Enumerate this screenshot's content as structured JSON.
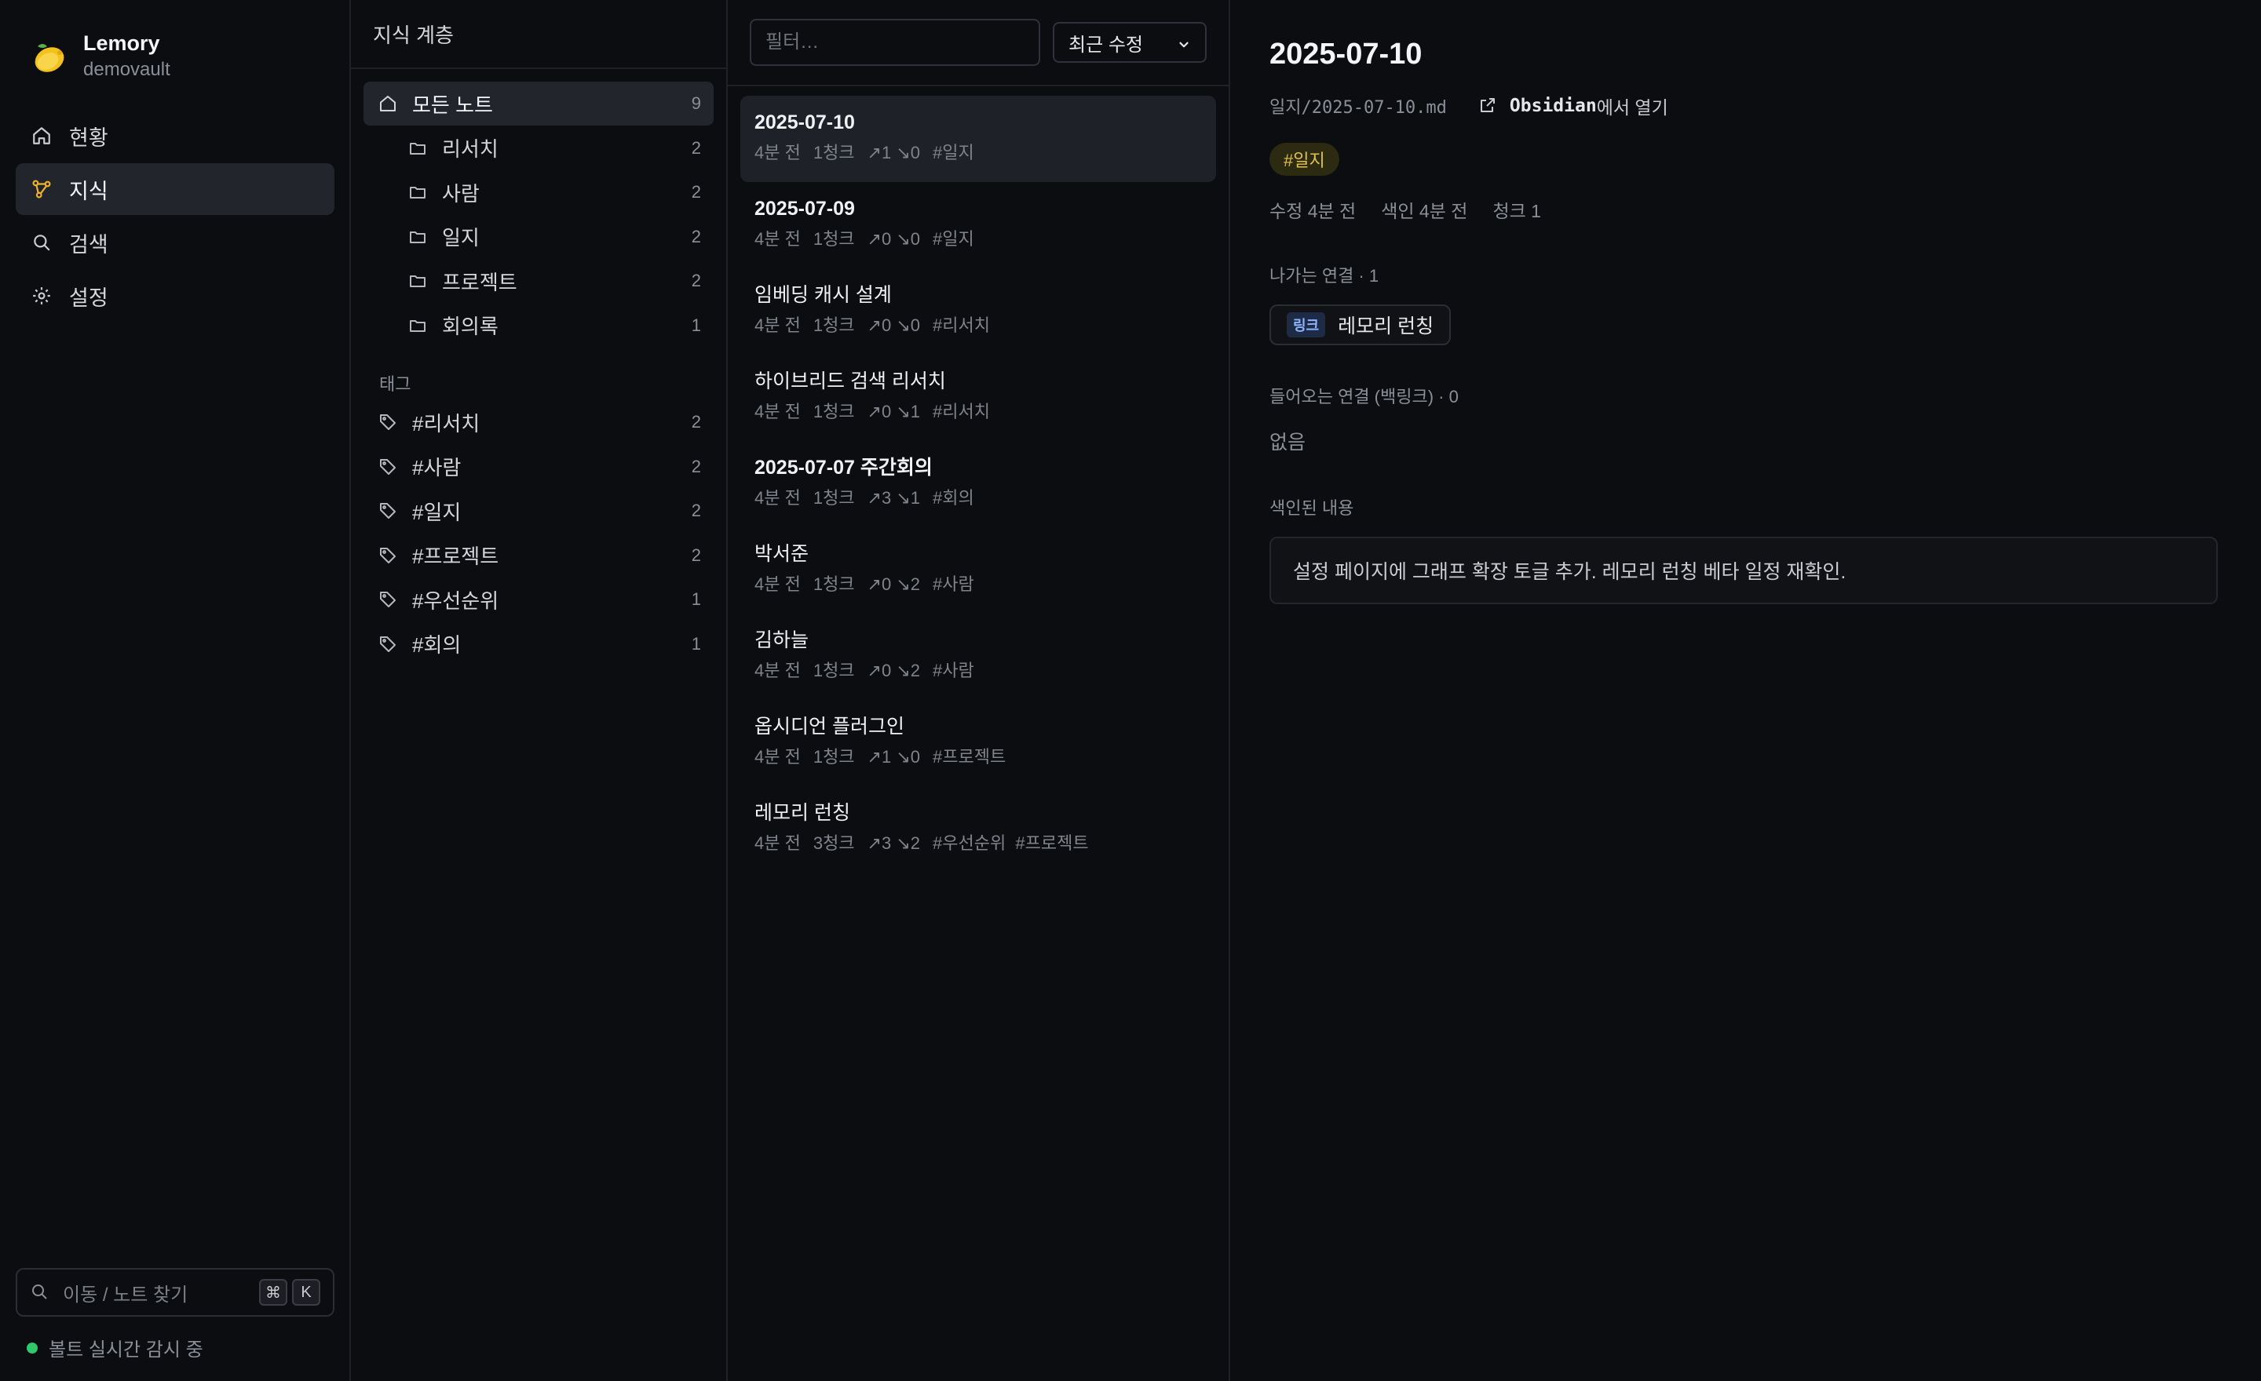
{
  "brand": {
    "name": "Lemory",
    "vault": "demovault"
  },
  "nav": [
    {
      "label": "현황",
      "icon": "home-icon"
    },
    {
      "label": "지식",
      "icon": "graph-icon",
      "active": true
    },
    {
      "label": "검색",
      "icon": "search-icon"
    },
    {
      "label": "설정",
      "icon": "gear-icon"
    }
  ],
  "quick_search": {
    "placeholder": "이동 / 노트 찾기",
    "key1": "⌘",
    "key2": "K"
  },
  "status": {
    "text": "볼트 실시간 감시 중",
    "color": "#2fc86a"
  },
  "tree": {
    "header": "지식 계층",
    "root": {
      "label": "모든 노트",
      "count": "9"
    },
    "folders": [
      {
        "label": "리서치",
        "count": "2"
      },
      {
        "label": "사람",
        "count": "2"
      },
      {
        "label": "일지",
        "count": "2"
      },
      {
        "label": "프로젝트",
        "count": "2"
      },
      {
        "label": "회의록",
        "count": "1"
      }
    ],
    "tags_label": "태그",
    "tags": [
      {
        "label": "#리서치",
        "count": "2"
      },
      {
        "label": "#사람",
        "count": "2"
      },
      {
        "label": "#일지",
        "count": "2"
      },
      {
        "label": "#프로젝트",
        "count": "2"
      },
      {
        "label": "#우선순위",
        "count": "1"
      },
      {
        "label": "#회의",
        "count": "1"
      }
    ]
  },
  "notes_panel": {
    "filter_placeholder": "필터…",
    "sort_label": "최근 수정",
    "items": [
      {
        "title": "2025-07-10",
        "time": "4분 전",
        "chunks": "1청크",
        "out": "↗1",
        "in": "↘0",
        "tags": "#일지",
        "bold": true,
        "active": true
      },
      {
        "title": "2025-07-09",
        "time": "4분 전",
        "chunks": "1청크",
        "out": "↗0",
        "in": "↘0",
        "tags": "#일지",
        "bold": true
      },
      {
        "title": "임베딩 캐시 설계",
        "time": "4분 전",
        "chunks": "1청크",
        "out": "↗0",
        "in": "↘0",
        "tags": "#리서치"
      },
      {
        "title": "하이브리드 검색 리서치",
        "time": "4분 전",
        "chunks": "1청크",
        "out": "↗0",
        "in": "↘1",
        "tags": "#리서치"
      },
      {
        "title": "2025-07-07 주간회의",
        "time": "4분 전",
        "chunks": "1청크",
        "out": "↗3",
        "in": "↘1",
        "tags": "#회의",
        "bold": true
      },
      {
        "title": "박서준",
        "time": "4분 전",
        "chunks": "1청크",
        "out": "↗0",
        "in": "↘2",
        "tags": "#사람"
      },
      {
        "title": "김하늘",
        "time": "4분 전",
        "chunks": "1청크",
        "out": "↗0",
        "in": "↘2",
        "tags": "#사람"
      },
      {
        "title": "옵시디언 플러그인",
        "time": "4분 전",
        "chunks": "1청크",
        "out": "↗1",
        "in": "↘0",
        "tags": "#프로젝트"
      },
      {
        "title": "레모리 런칭",
        "time": "4분 전",
        "chunks": "3청크",
        "out": "↗3",
        "in": "↘2",
        "tags": "#우선순위  #프로젝트"
      }
    ]
  },
  "detail": {
    "title": "2025-07-10",
    "path": "일지/2025-07-10.md",
    "open_brand": "Obsidian",
    "open_suffix": "에서 열기",
    "tag": "#일지",
    "stats": {
      "modified": "수정 4분 전",
      "indexed": "색인 4분 전",
      "chunks": "청크 1"
    },
    "outgoing_label": "나가는 연결 · 1",
    "outgoing": {
      "badge": "링크",
      "label": "레모리 런칭"
    },
    "incoming_label": "들어오는 연결 (백링크) · 0",
    "incoming_empty": "없음",
    "content_label": "색인된 내용",
    "content": "설정 페이지에 그래프 확장 토글 추가. 레모리 런칭 베타 일정 재확인."
  }
}
